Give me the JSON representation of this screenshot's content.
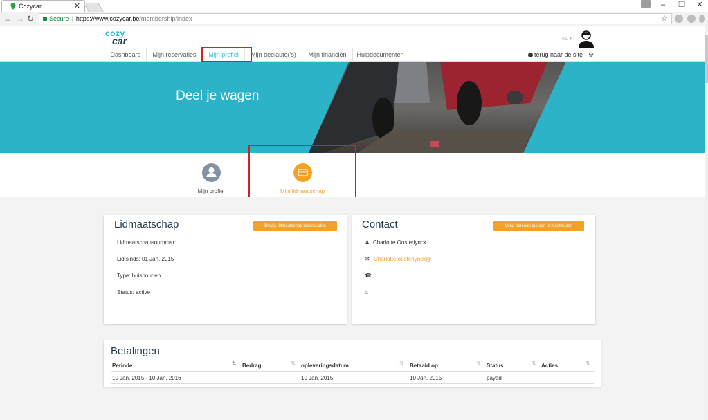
{
  "browser": {
    "tab_title": "Cozycar",
    "address": {
      "secure_label": "Secure",
      "host": "https://www.cozycar.be",
      "path": "/membership/index"
    }
  },
  "site": {
    "logo_line1": "cozy",
    "logo_line2": "car",
    "lang": "NL ▾",
    "nav": [
      "Dashboard",
      "Mijn reservaties",
      "Mijn profiel",
      "Mijn deelauto('s)",
      "Mijn financiën",
      "Hulpdocumenten"
    ],
    "back_to_site": "terug naar de site"
  },
  "banner": {
    "title": "Deel je wagen"
  },
  "profile_tabs": [
    {
      "label": "Mijn profiel",
      "color": "#8493a1",
      "active": false
    },
    {
      "label": "Mijn lidmaatschap",
      "color": "#f3a225",
      "active": true
    }
  ],
  "membership": {
    "title": "Lidmaatschap",
    "button": "Bewijs lidmaatschap downloaden",
    "lines": [
      "Lidmaatschapsnummer:",
      "Lid sinds: 01 Jan. 2015",
      "Type: huishouden",
      "Status: active"
    ]
  },
  "contact": {
    "title": "Contact",
    "button": "Voeg persoon toe aan je huishouden",
    "name": "Charlotte Oosterlynck",
    "email": "Charlotte.oosterlynck@",
    "phone": "",
    "address": ""
  },
  "payments": {
    "title": "Betalingen",
    "columns": [
      "Periode",
      "Bedrag",
      "opleveringsdatum",
      "Betaald op",
      "Status",
      "Acties"
    ],
    "rows": [
      {
        "periode": "10 Jan. 2015 - 10 Jan. 2016",
        "bedrag": "",
        "oplevering": "10 Jan. 2015",
        "betaald": "10 Jan. 2015",
        "status": "payed",
        "acties": ""
      }
    ]
  },
  "colors": {
    "accent": "#2cb3c8",
    "orange": "#f3a225",
    "highlight": "#d32027",
    "brand_dark": "#1f3a4c"
  }
}
